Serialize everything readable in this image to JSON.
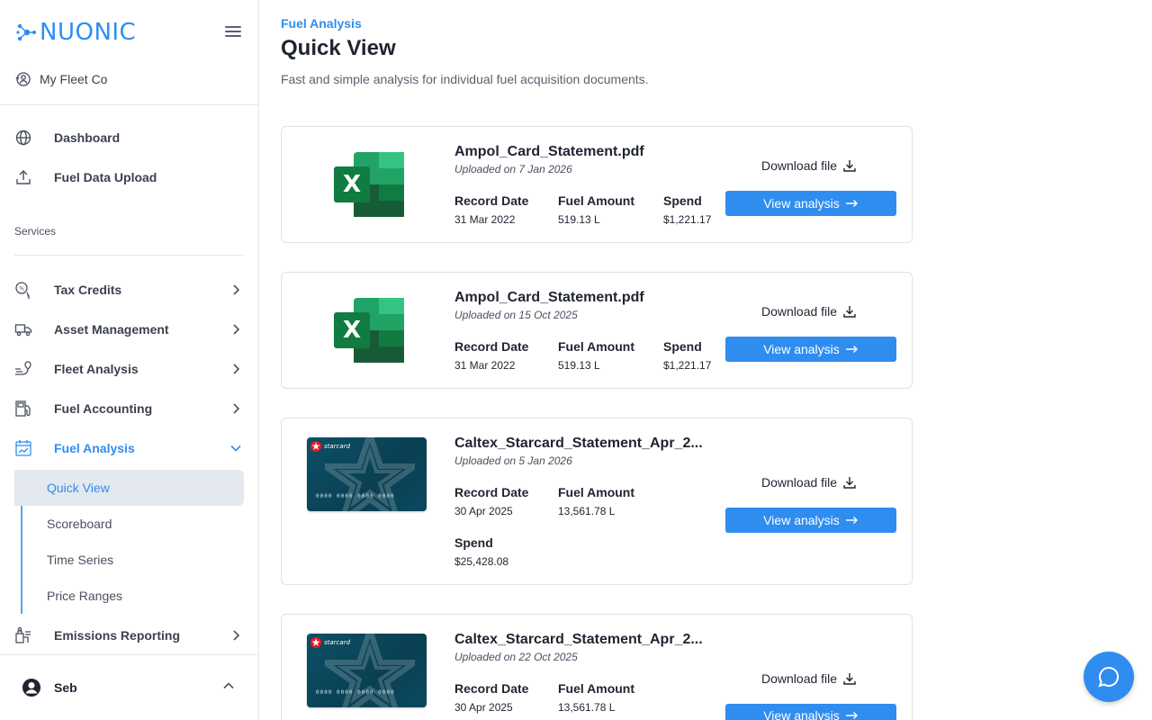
{
  "brand": {
    "name": "NUONIC",
    "accent": "#2f8df0"
  },
  "org": {
    "name": "My Fleet Co"
  },
  "sidebar": {
    "top_items": [
      {
        "label": "Dashboard",
        "icon": "globe-icon"
      },
      {
        "label": "Fuel Data Upload",
        "icon": "upload-icon"
      }
    ],
    "services_label": "Services",
    "service_items": [
      {
        "label": "Tax Credits",
        "icon": "tax-credits-icon"
      },
      {
        "label": "Asset Management",
        "icon": "truck-icon"
      },
      {
        "label": "Fleet Analysis",
        "icon": "fleet-route-icon"
      },
      {
        "label": "Fuel Accounting",
        "icon": "fuel-pump-icon"
      },
      {
        "label": "Fuel Analysis",
        "icon": "fuel-analysis-icon"
      },
      {
        "label": "Emissions Reporting",
        "icon": "emissions-icon"
      }
    ],
    "fuel_analysis_sub": [
      {
        "label": "Quick View"
      },
      {
        "label": "Scoreboard"
      },
      {
        "label": "Time Series"
      },
      {
        "label": "Price Ranges"
      }
    ],
    "user": {
      "name": "Seb"
    }
  },
  "main": {
    "breadcrumb": "Fuel Analysis",
    "title": "Quick View",
    "subtitle": "Fast and simple analysis for individual fuel acquisition documents.",
    "labels": {
      "record_date": "Record Date",
      "fuel_amount": "Fuel Amount",
      "spend": "Spend",
      "download": "Download file",
      "view": "View analysis"
    },
    "cards": [
      {
        "thumb": "excel",
        "file": "Ampol_Card_Statement.pdf",
        "uploaded": "Uploaded on 7 Jan 2026",
        "record_date": "31 Mar 2022",
        "fuel_amount": "519.13 L",
        "spend": "$1,221.17"
      },
      {
        "thumb": "excel",
        "file": "Ampol_Card_Statement.pdf",
        "uploaded": "Uploaded on 15 Oct 2025",
        "record_date": "31 Mar 2022",
        "fuel_amount": "519.13 L",
        "spend": "$1,221.17"
      },
      {
        "thumb": "starcard",
        "file": "Caltex_Starcard_Statement_Apr_2...",
        "uploaded": "Uploaded on 5 Jan 2026",
        "record_date": "30 Apr 2025",
        "fuel_amount": "13,561.78 L",
        "spend": "$25,428.08"
      },
      {
        "thumb": "starcard",
        "file": "Caltex_Starcard_Statement_Apr_2...",
        "uploaded": "Uploaded on 22 Oct 2025",
        "record_date": "30 Apr 2025",
        "fuel_amount": "13,561.78 L",
        "spend": ""
      }
    ],
    "starcard": {
      "brand": "starcard",
      "numbers": "0000 0000 0000 0000"
    }
  },
  "chat": {
    "icon": "chat-bubble-icon"
  }
}
